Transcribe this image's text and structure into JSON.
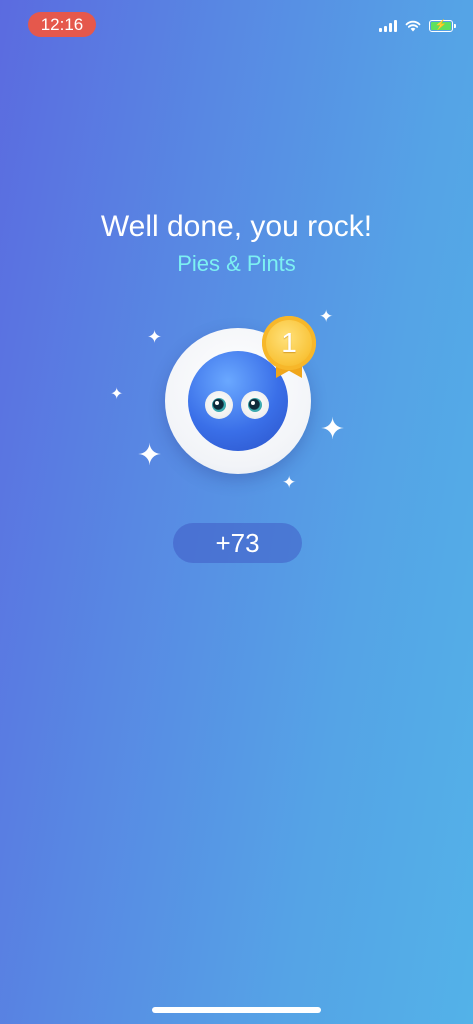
{
  "status_bar": {
    "time": "12:16",
    "icons": [
      "cellular-signal-icon",
      "wifi-icon",
      "battery-charging-icon"
    ]
  },
  "result": {
    "title": "Well done, you rock!",
    "subtitle": "Pies & Pints",
    "rank": "1",
    "points": "+73"
  },
  "colors": {
    "background_start": "#5b6be0",
    "background_end": "#53b2e8",
    "subtitle": "#7df0f2",
    "medal": "#f9c43a",
    "time_pill": "#e5584c"
  }
}
